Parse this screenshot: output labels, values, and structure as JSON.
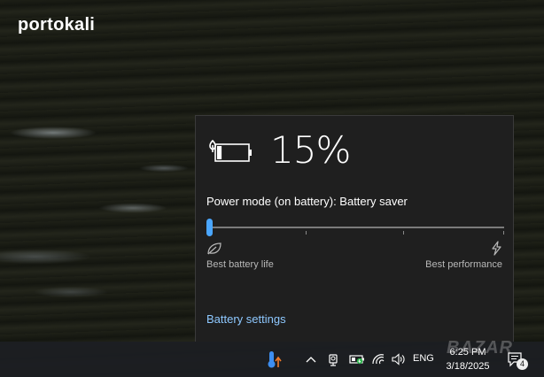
{
  "desktop": {
    "brand_text": "portokali",
    "watermark_text": "BAZAR"
  },
  "battery_flyout": {
    "percent_text": "15%",
    "level_fraction": 0.15,
    "status_icon": "battery-saver-battery-icon",
    "power_mode_label": "Power mode (on battery): Battery saver",
    "slider": {
      "position_index": 0,
      "stops": 4
    },
    "left_label": "Best battery life",
    "right_label": "Best performance",
    "left_icon": "leaf-icon",
    "right_icon": "lightning-bolt-icon",
    "settings_link": "Battery settings",
    "accent_color": "#4aa6ff",
    "link_color": "#8ec8ff"
  },
  "taskbar": {
    "tray_icons": [
      "thermometer-app-icon",
      "chevron-up-icon",
      "meet-now-icon",
      "battery-charging-icon",
      "wifi-icon",
      "volume-icon"
    ],
    "language": "ENG",
    "time": "6:25 PM",
    "date": "3/18/2025",
    "notification_count": "4"
  }
}
